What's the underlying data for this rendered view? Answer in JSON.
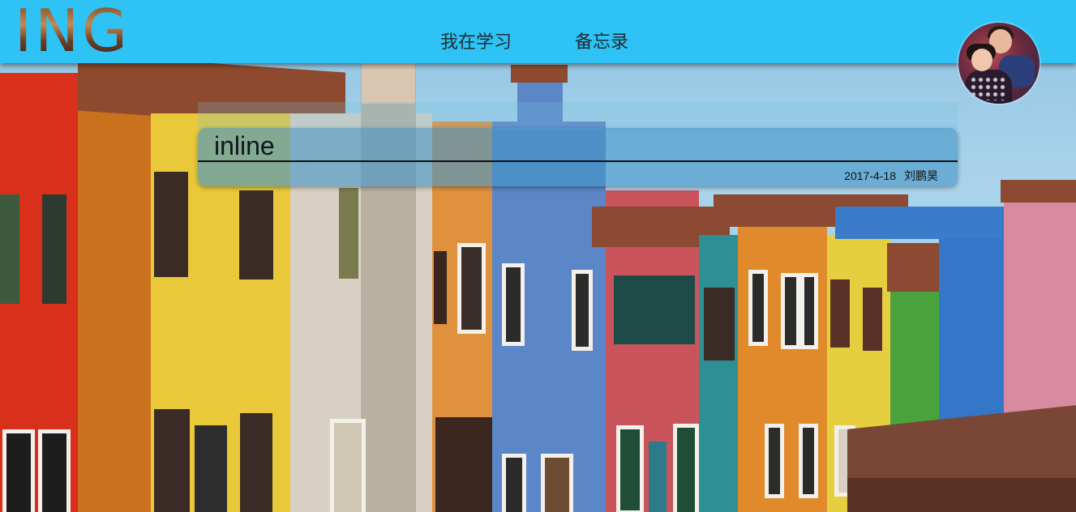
{
  "header": {
    "logo": "ING",
    "nav": [
      "我在学习",
      "备忘录"
    ]
  },
  "user": {
    "avatar_icon": "user-avatar-photo"
  },
  "post": {
    "title": "inline",
    "date": "2017-4-18",
    "author": "刘鹏昊"
  },
  "colors": {
    "header_bg": "#2ec2f5",
    "card_bg": "rgba(70,150,200,0.62)"
  }
}
